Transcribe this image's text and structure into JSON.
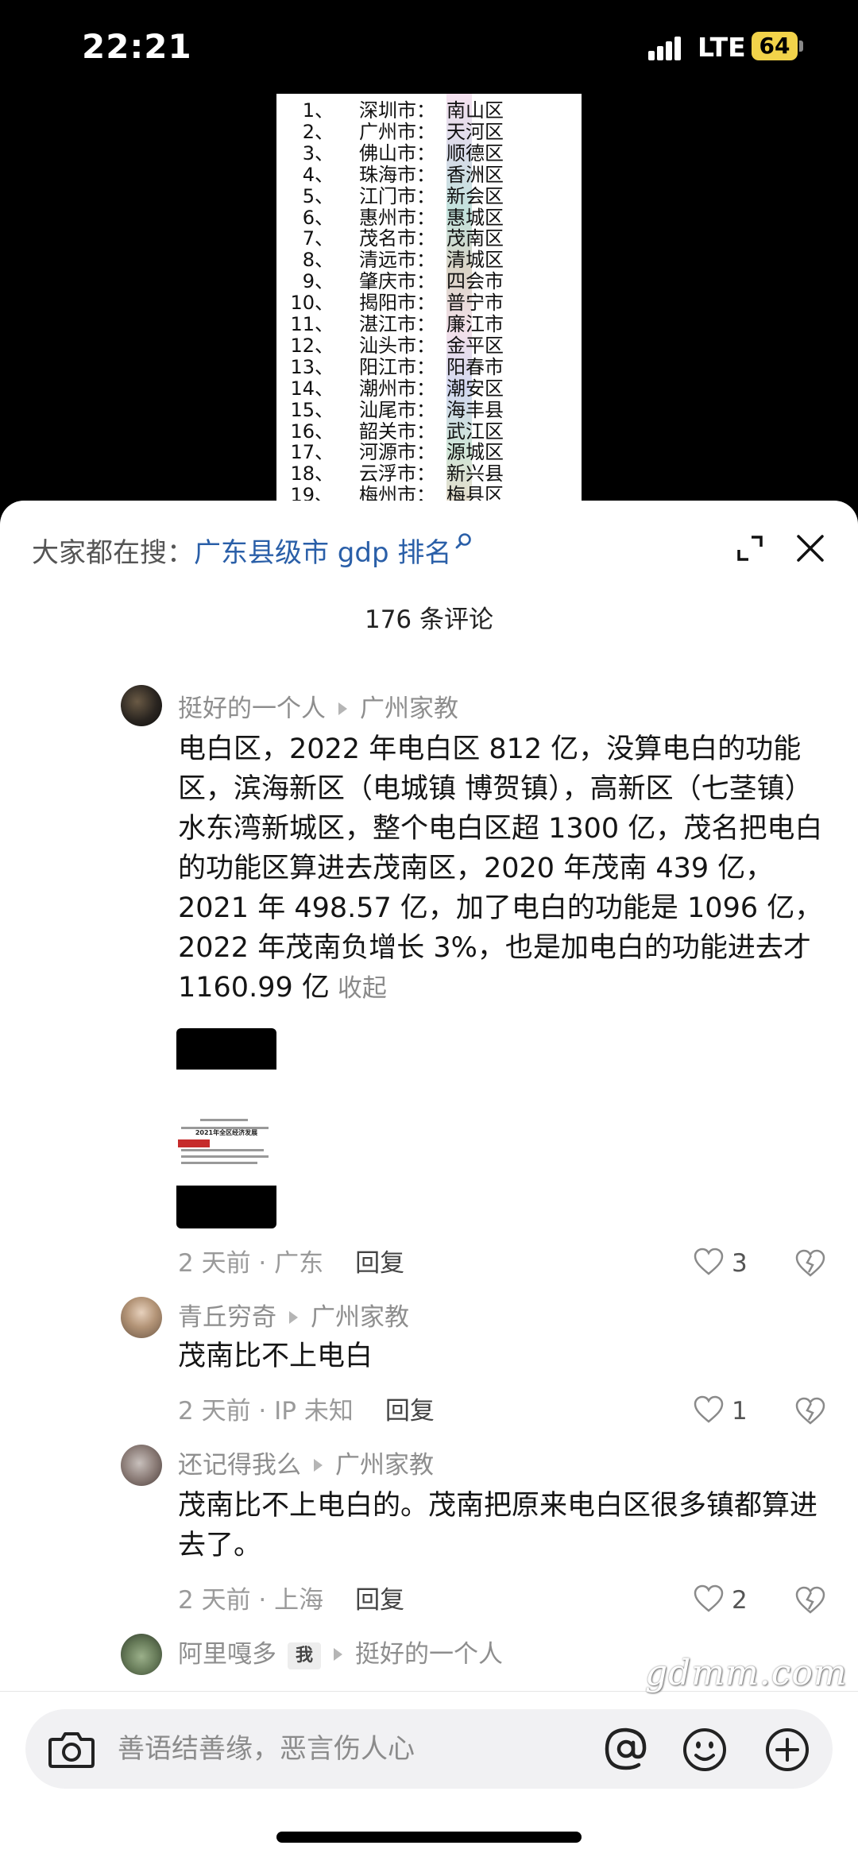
{
  "status_bar": {
    "time": "22:21",
    "network": "LTE",
    "battery": "64",
    "battery_color": "#f2d34a"
  },
  "background_image": {
    "rows": [
      {
        "num": "1、",
        "city": "深圳市：",
        "district": "南山区"
      },
      {
        "num": "2、",
        "city": "广州市：",
        "district": "天河区"
      },
      {
        "num": "3、",
        "city": "佛山市：",
        "district": "顺德区"
      },
      {
        "num": "4、",
        "city": "珠海市：",
        "district": "香洲区"
      },
      {
        "num": "5、",
        "city": "江门市：",
        "district": "新会区"
      },
      {
        "num": "6、",
        "city": "惠州市：",
        "district": "惠城区"
      },
      {
        "num": "7、",
        "city": "茂名市：",
        "district": "茂南区"
      },
      {
        "num": "8、",
        "city": "清远市：",
        "district": "清城区"
      },
      {
        "num": "9、",
        "city": "肇庆市：",
        "district": "四会市"
      },
      {
        "num": "10、",
        "city": "揭阳市：",
        "district": "普宁市"
      },
      {
        "num": "11、",
        "city": "湛江市：",
        "district": "廉江市"
      },
      {
        "num": "12、",
        "city": "汕头市：",
        "district": "金平区"
      },
      {
        "num": "13、",
        "city": "阳江市：",
        "district": "阳春市"
      },
      {
        "num": "14、",
        "city": "潮州市：",
        "district": "潮安区"
      },
      {
        "num": "15、",
        "city": "汕尾市：",
        "district": "海丰县"
      },
      {
        "num": "16、",
        "city": "韶关市：",
        "district": "武江区"
      },
      {
        "num": "17、",
        "city": "河源市：",
        "district": "源城区"
      },
      {
        "num": "18、",
        "city": "云浮市：",
        "district": "新兴县"
      },
      {
        "num": "19、",
        "city": "梅州市：",
        "district": "梅县区"
      }
    ]
  },
  "search": {
    "prefix": "大家都在搜：",
    "query": "广东县级市 gdp 排名",
    "accent_color": "#2a5fa8"
  },
  "comment_count": "176 条评论",
  "comments": [
    {
      "user": "挺好的一个人",
      "reply_to": "广州家教",
      "text": "电白区，2022 年电白区 812 亿，没算电白的功能区，滨海新区（电城镇 博贺镇），高新区（七茎镇）水东湾新城区，整个电白区超 1300 亿，茂名把电白的功能区算进去茂南区，2020 年茂南 439 亿，2021 年 498.57 亿，加了电白的功能是 1096 亿，2022 年茂南负增长 3%，也是加电白的功能进去才 1160.99 亿",
      "collapse": "收起",
      "thumb_title": "2021年全区经济发展",
      "time_location": "2 天前 · 广东",
      "reply": "回复",
      "likes": "3"
    },
    {
      "user": "青丘穷奇",
      "reply_to": "广州家教",
      "text": "茂南比不上电白",
      "time_location": "2 天前 · IP 未知",
      "reply": "回复",
      "likes": "1"
    },
    {
      "user": "还记得我么",
      "reply_to": "广州家教",
      "text": "茂南比不上电白的。茂南把原来电白区很多镇都算进去了。",
      "time_location": "2 天前 · 上海",
      "reply": "回复",
      "likes": "2"
    },
    {
      "user": "阿里嘎多",
      "badge": "我",
      "reply_to": "挺好的一个人"
    }
  ],
  "input": {
    "placeholder": "善语结善缘，恶言伤人心"
  },
  "watermark": "gdmm.com"
}
